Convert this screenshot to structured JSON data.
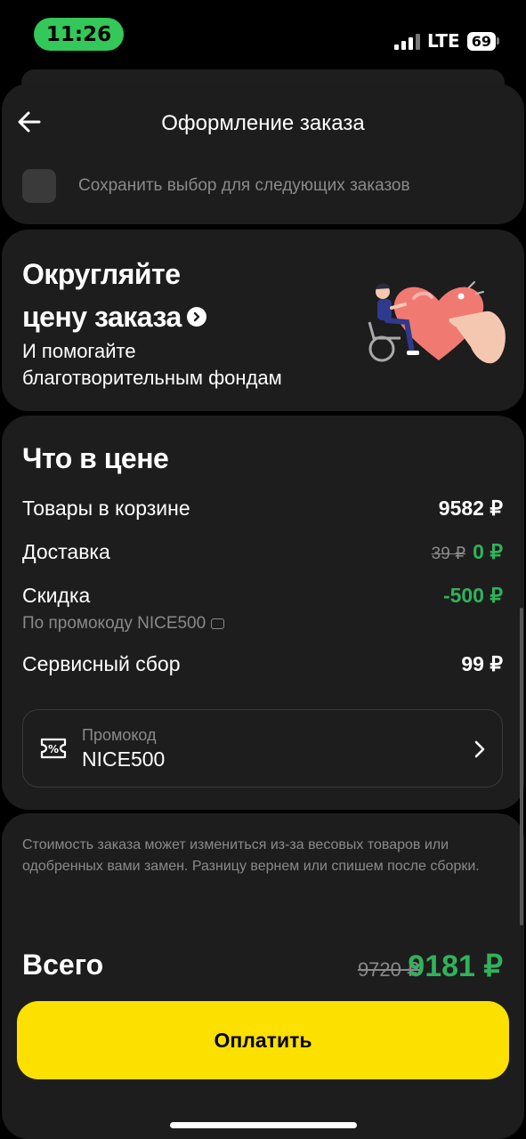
{
  "status_bar": {
    "time": "11:26",
    "network": "LTE",
    "battery": "69"
  },
  "header": {
    "title": "Оформление заказа"
  },
  "save_choice": {
    "label": "Сохранить выбор для следующих заказов",
    "checked": false
  },
  "round_up_promo": {
    "title_line1": "Округляйте",
    "title_line2": "цену заказа",
    "subtitle_line1": "И помогайте",
    "subtitle_line2": "благотворительным фондам"
  },
  "price_breakdown": {
    "title": "Что в цене",
    "rows": [
      {
        "label": "Товары в корзине",
        "value": "9582 ₽"
      },
      {
        "label": "Доставка",
        "old_value": "39 ₽",
        "value": "0 ₽"
      },
      {
        "label": "Скидка",
        "value": "-500 ₽",
        "note": "По промокоду NICE500"
      },
      {
        "label": "Сервисный сбор",
        "value": "99 ₽"
      }
    ]
  },
  "promo_code": {
    "placeholder": "Промокод",
    "value": "NICE500"
  },
  "disclaimer": "Стоимость заказа может измениться из-за весовых товаров или одобренных вами замен. Разницу вернем или спишем после сборки.",
  "total": {
    "label": "Всего",
    "old_value": "9720 ₽",
    "value": "9181 ₽"
  },
  "pay_button": {
    "label": "Оплатить"
  },
  "colors": {
    "accent_yellow": "#fce000",
    "green": "#2fb35a",
    "card_bg": "#1d1d1d"
  }
}
